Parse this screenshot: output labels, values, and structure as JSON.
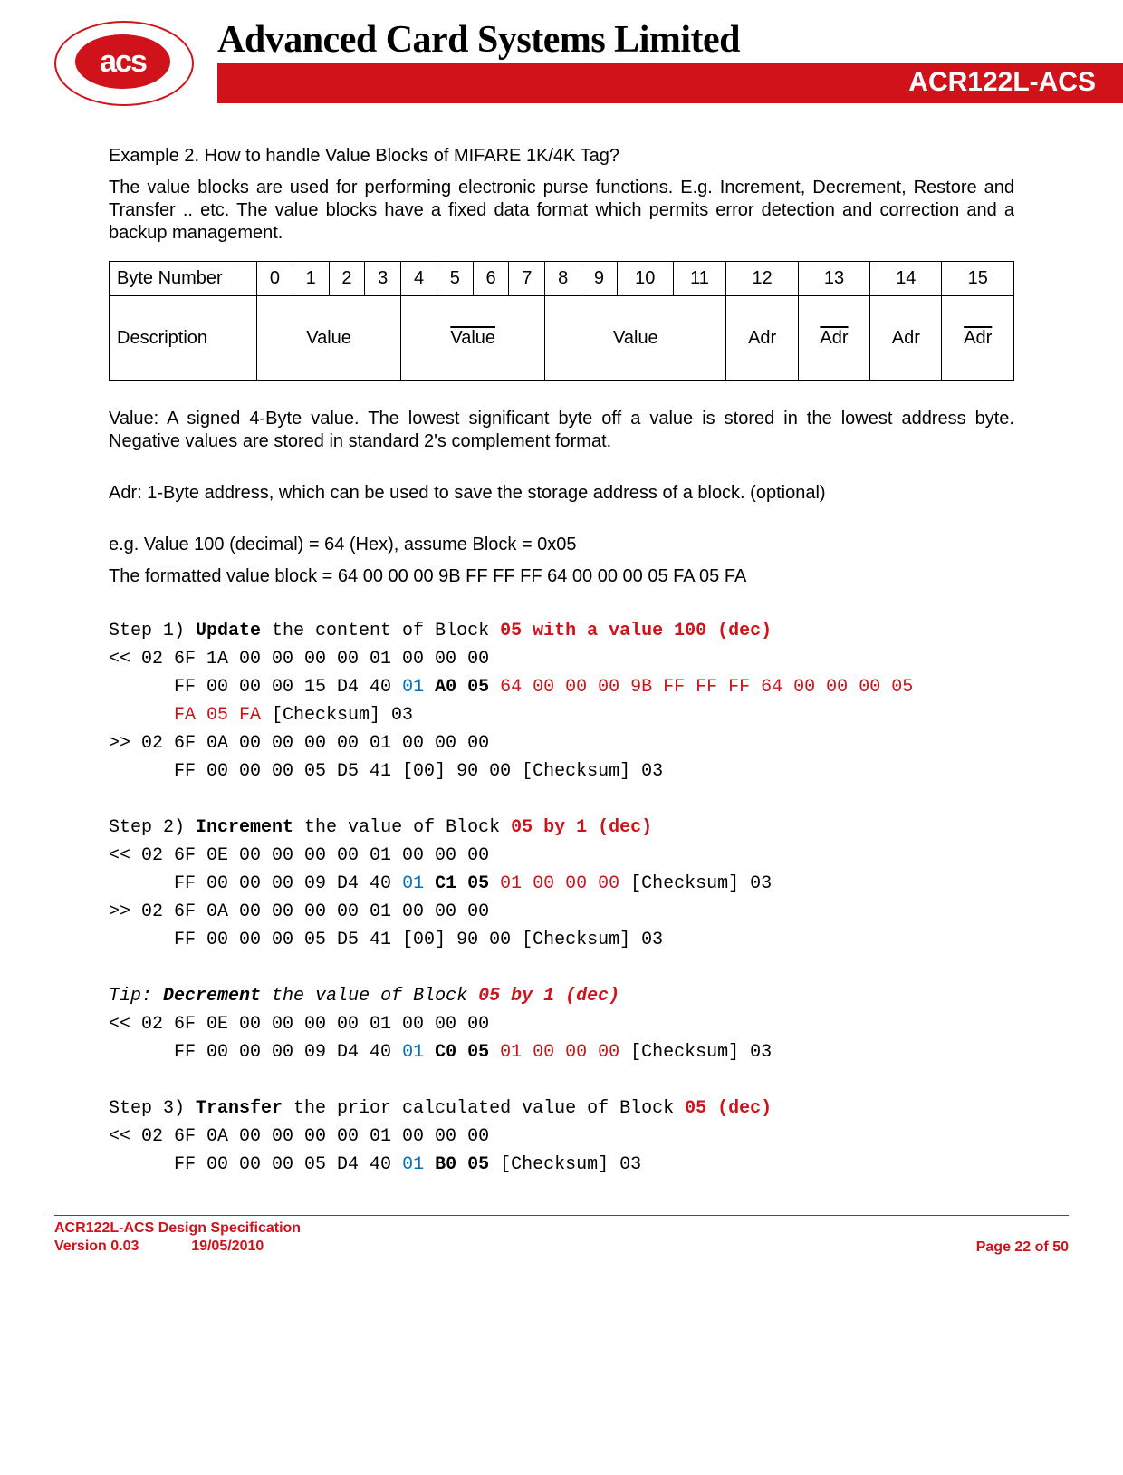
{
  "header": {
    "logo_text": "acs",
    "company": "Advanced Card Systems Limited",
    "product": "ACR122L-ACS"
  },
  "body": {
    "p1": "Example 2. How to handle Value Blocks of MIFARE 1K/4K Tag?",
    "p2": "The value blocks are used for performing electronic purse functions. E.g. Increment, Decrement, Restore and Transfer .. etc. The value blocks have a fixed data format which permits error detection and correction and a backup management.",
    "table": {
      "row1_label": "Byte Number",
      "cols": [
        "0",
        "1",
        "2",
        "3",
        "4",
        "5",
        "6",
        "7",
        "8",
        "9",
        "10",
        "11",
        "12",
        "13",
        "14",
        "15"
      ],
      "row2_label": "Description",
      "value": "Value",
      "adr": "Adr"
    },
    "p3": "Value: A signed 4-Byte value. The lowest significant byte off a value is stored in the lowest address byte. Negative values are stored in standard 2's complement format.",
    "p4": "Adr: 1-Byte address, which can be used to save the storage address of a block. (optional)",
    "p5": "e.g. Value 100 (decimal) = 64 (Hex), assume Block = 0x05",
    "p6": "The formatted value block = 64 00 00 00 9B FF FF FF 64 00 00 00 05 FA 05 FA",
    "step1": {
      "pre": "Step 1) ",
      "bold": "Update",
      "mid": " the content of Block ",
      "redbold": "05 with a value 100 (dec)"
    },
    "s1l1": "<< 02 6F 1A 00 00 00 00 01 00 00 00",
    "s1l2a": "      FF 00 00 00 15 D4 40 ",
    "s1l2_blue": "01",
    "s1l2b": " ",
    "s1l2_bold": "A0 05",
    "s1l2c": " ",
    "s1l2_red": "64 00 00 00 9B FF FF FF 64 00 00 00 05",
    "s1l3_red": "      FA 05 FA",
    "s1l3b": " [Checksum] 03",
    "s1l4": ">> 02 6F 0A 00 00 00 00 01 00 00 00",
    "s1l5": "      FF 00 00 00 05 D5 41 [00] 90 00 [Checksum] 03",
    "step2": {
      "pre": "Step 2) ",
      "bold": "Increment",
      "mid": " the value of Block ",
      "redbold": "05 by 1 (dec)"
    },
    "s2l1": "<< 02 6F 0E 00 00 00 00 01 00 00 00",
    "s2l2a": "      FF 00 00 00 09 D4 40 ",
    "s2l2_blue": "01",
    "s2l2b": " ",
    "s2l2_bold": "C1 05",
    "s2l2c": " ",
    "s2l2_red": "01 00 00 00",
    "s2l2d": " [Checksum] 03",
    "s2l3": ">> 02 6F 0A 00 00 00 00 01 00 00 00",
    "s2l4": "      FF 00 00 00 05 D5 41 [00] 90 00 [Checksum] 03",
    "tip": {
      "pre": "Tip: ",
      "bold": "Decrement",
      "mid": " the value of Block ",
      "redbold": "05 by 1 (dec)"
    },
    "t1l1": "<< 02 6F 0E 00 00 00 00 01 00 00 00",
    "t1l2a": "      FF 00 00 00 09 D4 40 ",
    "t1l2_blue": "01",
    "t1l2b": " ",
    "t1l2_bold": "C0 05",
    "t1l2c": " ",
    "t1l2_red": "01 00 00 00",
    "t1l2d": " [Checksum] 03",
    "step3": {
      "pre": "Step 3) ",
      "bold": "Transfer",
      "mid": " the prior calculated value of Block ",
      "redbold": "05 (dec)"
    },
    "s3l1": "<< 02 6F 0A 00 00 00 00 01 00 00 00",
    "s3l2a": "      FF 00 00 00 05 D4 40 ",
    "s3l2_blue": "01",
    "s3l2b": " ",
    "s3l2_bold": "B0 05",
    "s3l2c": " [Checksum] 03"
  },
  "footer": {
    "line1": "ACR122L-ACS Design Specification",
    "version": "Version 0.03",
    "date": "19/05/2010",
    "page": "Page 22 of 50"
  }
}
